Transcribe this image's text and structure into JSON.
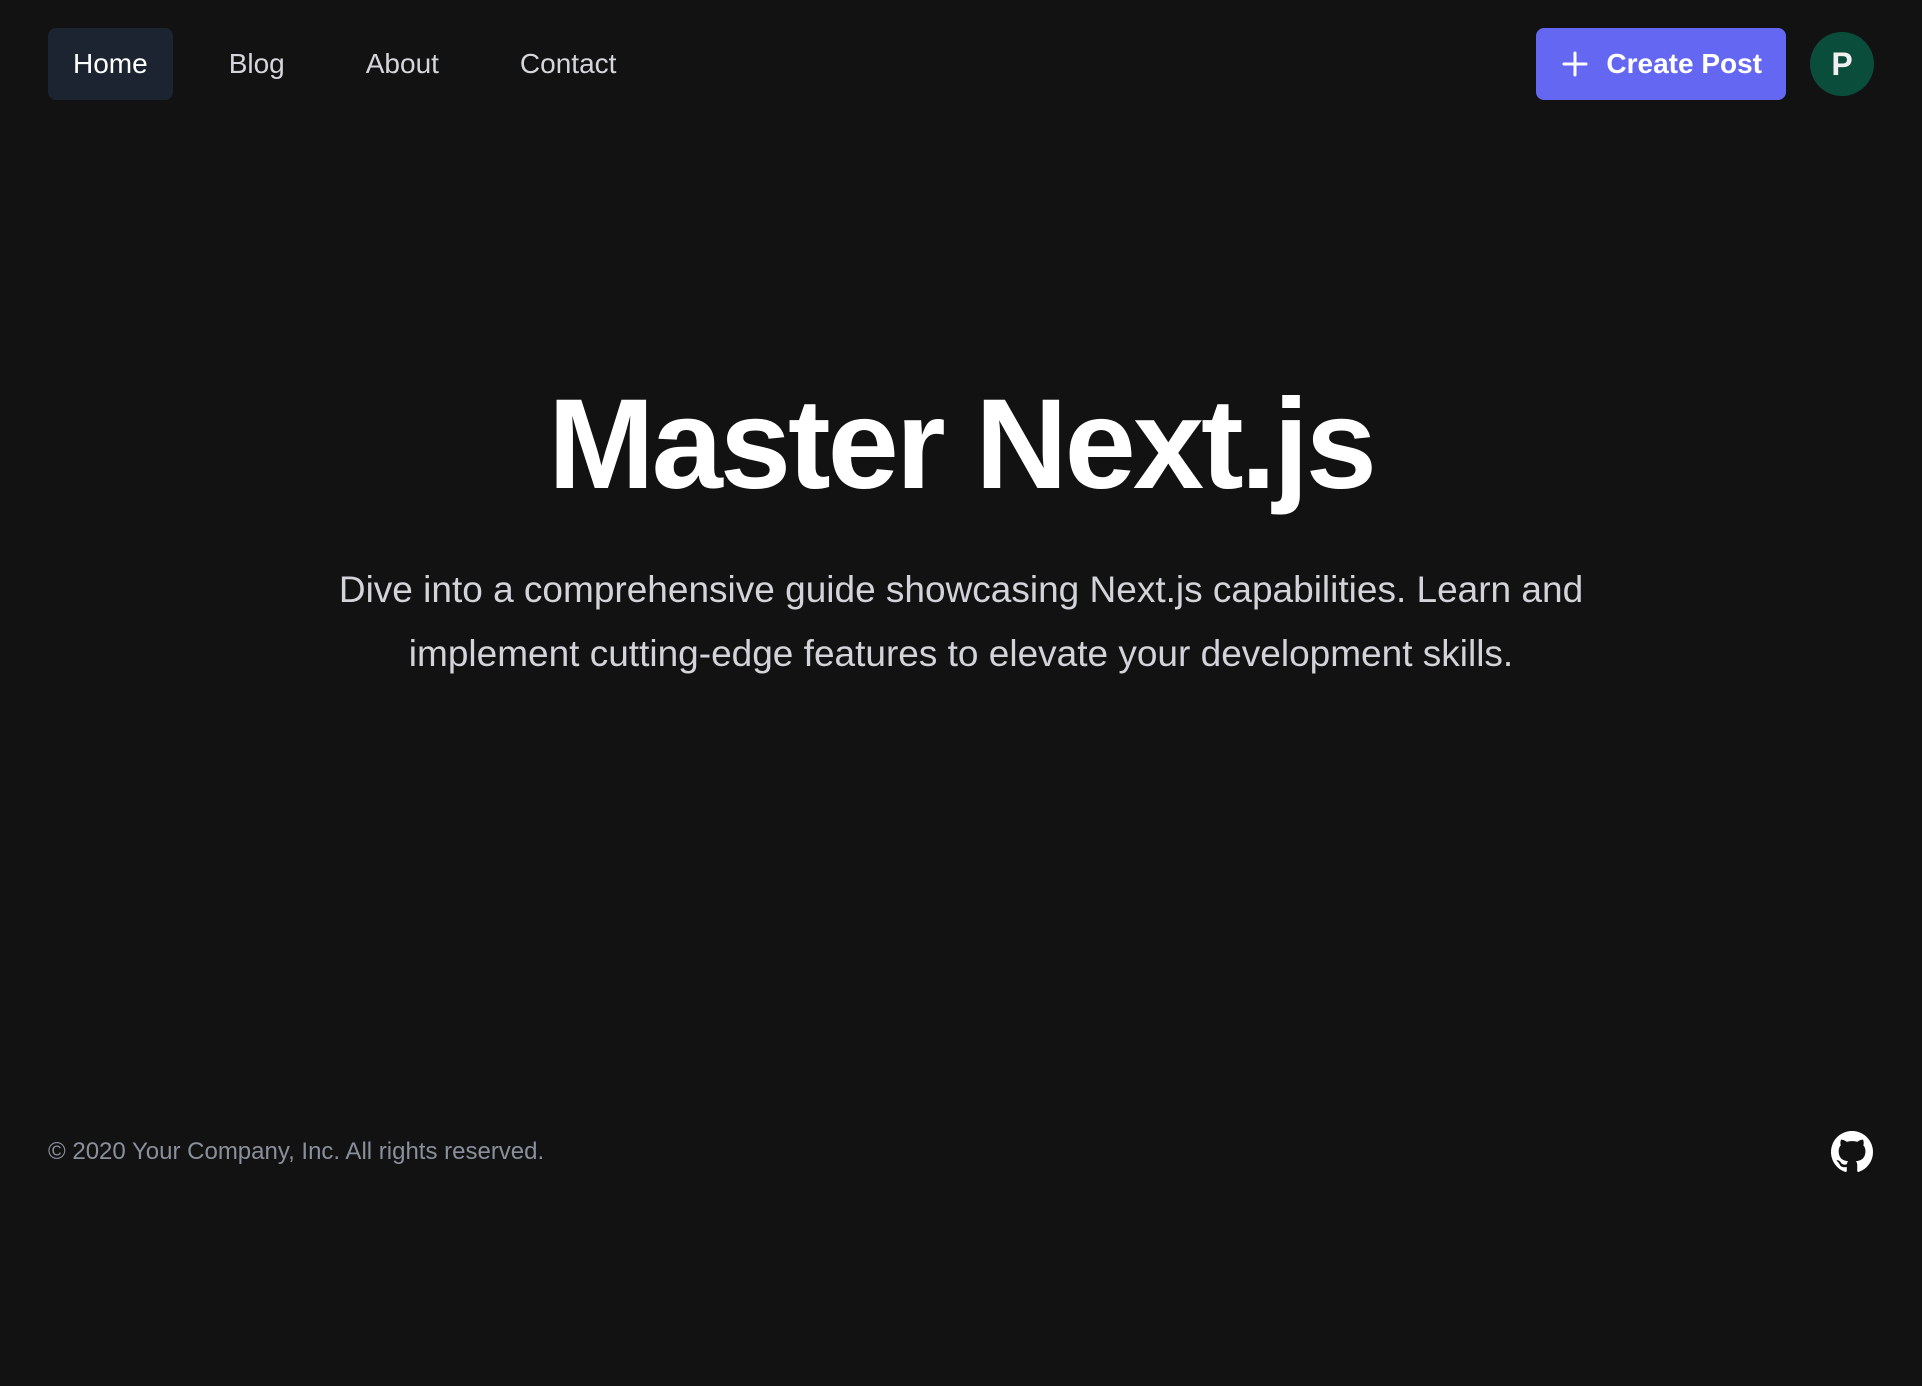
{
  "nav": {
    "items": [
      {
        "label": "Home",
        "active": true
      },
      {
        "label": "Blog",
        "active": false
      },
      {
        "label": "About",
        "active": false
      },
      {
        "label": "Contact",
        "active": false
      }
    ]
  },
  "actions": {
    "create_post_label": "Create Post",
    "create_post_icon": "plus-icon",
    "avatar_initial": "P"
  },
  "hero": {
    "title": "Master Next.js",
    "subtitle": "Dive into a comprehensive guide showcasing Next.js capabilities. Learn and implement cutting-edge features to elevate your development skills."
  },
  "footer": {
    "copyright": "© 2020 Your Company, Inc. All rights reserved.",
    "social_icon": "github-icon"
  },
  "colors": {
    "background": "#121212",
    "accent": "#6467f2",
    "avatar": "#0b4d3b",
    "active_nav": "#1d2431"
  }
}
